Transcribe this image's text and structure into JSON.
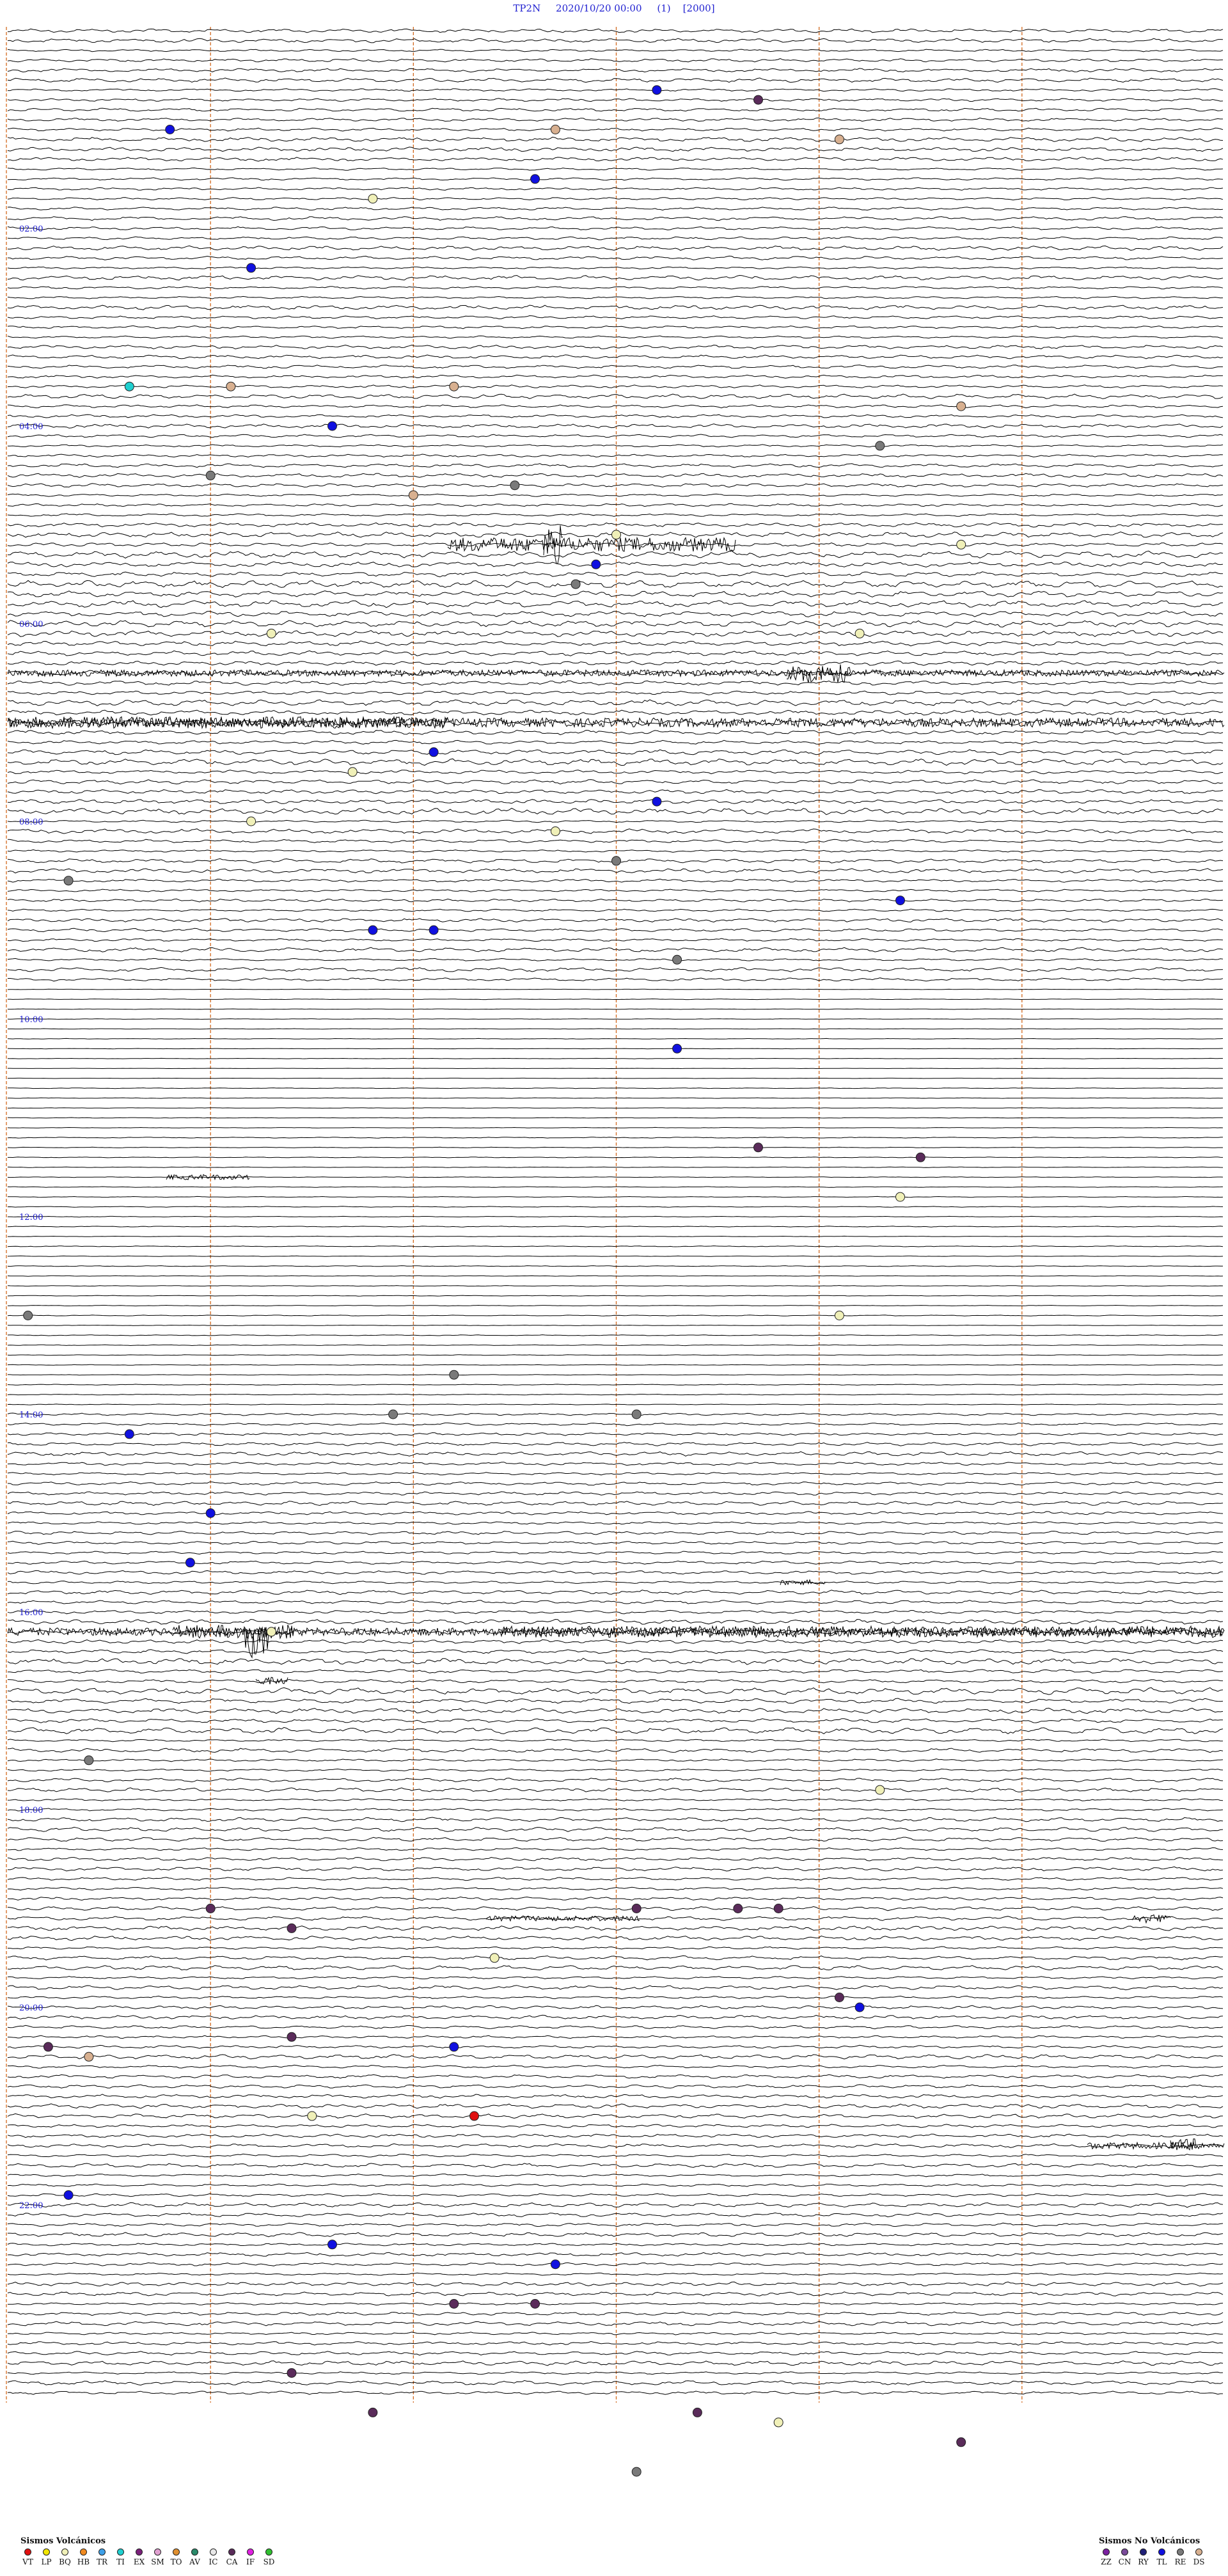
{
  "header": {
    "station": "TP2N",
    "datetime": "2020/10/20 00:00",
    "channel": "(1)",
    "scale": "[2000]"
  },
  "chart_data": {
    "type": "helicorder",
    "title": "TP2N    2020/10/20 00:00    (1)    [2000]",
    "hour_labels": [
      {
        "hour": 2,
        "label": "02:00"
      },
      {
        "hour": 4,
        "label": "04:00"
      },
      {
        "hour": 6,
        "label": "06:00"
      },
      {
        "hour": 8,
        "label": "08:00"
      },
      {
        "hour": 10,
        "label": "10:00"
      },
      {
        "hour": 12,
        "label": "12:00"
      },
      {
        "hour": 14,
        "label": "14:00"
      },
      {
        "hour": 16,
        "label": "16:00"
      },
      {
        "hour": 18,
        "label": "18:00"
      },
      {
        "hour": 20,
        "label": "20:00"
      },
      {
        "hour": 22,
        "label": "22:00"
      }
    ],
    "hours": 24,
    "traces_per_hour": 10,
    "minutes_per_trace": 6,
    "minute_gridlines": [
      1,
      2,
      3,
      4,
      5
    ],
    "trace_colors": {
      "trace": "#000000",
      "grid": "#d2691e",
      "hour_label": "#1f1fd0"
    },
    "events": [
      {
        "time_h": 0.6,
        "minute": 3.2,
        "class": "TL"
      },
      {
        "time_h": 0.7,
        "minute": 3.7,
        "class": "CA"
      },
      {
        "time_h": 1.0,
        "minute": 0.8,
        "class": "TL"
      },
      {
        "time_h": 1.0,
        "minute": 2.7,
        "class": "DS"
      },
      {
        "time_h": 1.1,
        "minute": 4.1,
        "class": "DS"
      },
      {
        "time_h": 1.5,
        "minute": 2.6,
        "class": "TL"
      },
      {
        "time_h": 1.7,
        "minute": 1.8,
        "class": "BQ"
      },
      {
        "time_h": 2.4,
        "minute": 1.2,
        "class": "TL"
      },
      {
        "time_h": 3.6,
        "minute": 0.6,
        "class": "TI"
      },
      {
        "time_h": 3.6,
        "minute": 1.1,
        "class": "DS"
      },
      {
        "time_h": 3.6,
        "minute": 2.2,
        "class": "DS"
      },
      {
        "time_h": 3.8,
        "minute": 4.7,
        "class": "DS"
      },
      {
        "time_h": 4.0,
        "minute": 1.6,
        "class": "TL"
      },
      {
        "time_h": 4.2,
        "minute": 4.3,
        "class": "RE"
      },
      {
        "time_h": 4.5,
        "minute": 1.0,
        "class": "RE"
      },
      {
        "time_h": 4.6,
        "minute": 2.5,
        "class": "RE"
      },
      {
        "time_h": 4.7,
        "minute": 2.0,
        "class": "DS"
      },
      {
        "time_h": 5.1,
        "minute": 3.0,
        "class": "BQ"
      },
      {
        "time_h": 5.2,
        "minute": 4.7,
        "class": "BQ"
      },
      {
        "time_h": 5.4,
        "minute": 2.9,
        "class": "TL"
      },
      {
        "time_h": 5.6,
        "minute": 2.8,
        "class": "RE"
      },
      {
        "time_h": 6.1,
        "minute": 1.3,
        "class": "BQ"
      },
      {
        "time_h": 6.1,
        "minute": 4.2,
        "class": "BQ"
      },
      {
        "time_h": 7.3,
        "minute": 2.1,
        "class": "TL"
      },
      {
        "time_h": 7.5,
        "minute": 1.7,
        "class": "BQ"
      },
      {
        "time_h": 7.8,
        "minute": 3.2,
        "class": "TL"
      },
      {
        "time_h": 8.0,
        "minute": 1.2,
        "class": "BQ"
      },
      {
        "time_h": 8.1,
        "minute": 2.7,
        "class": "BQ"
      },
      {
        "time_h": 8.4,
        "minute": 3.0,
        "class": "RE"
      },
      {
        "time_h": 8.6,
        "minute": 0.3,
        "class": "RE"
      },
      {
        "time_h": 8.8,
        "minute": 4.4,
        "class": "TL"
      },
      {
        "time_h": 9.1,
        "minute": 1.8,
        "class": "TL"
      },
      {
        "time_h": 9.1,
        "minute": 2.1,
        "class": "TL"
      },
      {
        "time_h": 9.4,
        "minute": 3.3,
        "class": "RE"
      },
      {
        "time_h": 10.3,
        "minute": 3.3,
        "class": "TL"
      },
      {
        "time_h": 11.3,
        "minute": 3.7,
        "class": "CA"
      },
      {
        "time_h": 11.4,
        "minute": 4.5,
        "class": "CA"
      },
      {
        "time_h": 11.8,
        "minute": 4.4,
        "class": "BQ"
      },
      {
        "time_h": 13.0,
        "minute": 0.1,
        "class": "RE"
      },
      {
        "time_h": 13.0,
        "minute": 4.1,
        "class": "BQ"
      },
      {
        "time_h": 13.6,
        "minute": 2.2,
        "class": "RE"
      },
      {
        "time_h": 14.0,
        "minute": 1.9,
        "class": "RE"
      },
      {
        "time_h": 14.0,
        "minute": 3.1,
        "class": "RE"
      },
      {
        "time_h": 14.2,
        "minute": 0.6,
        "class": "TL"
      },
      {
        "time_h": 15.0,
        "minute": 1.0,
        "class": "TL"
      },
      {
        "time_h": 15.5,
        "minute": 0.9,
        "class": "TL"
      },
      {
        "time_h": 16.2,
        "minute": 1.3,
        "class": "BQ"
      },
      {
        "time_h": 17.5,
        "minute": 0.4,
        "class": "RE"
      },
      {
        "time_h": 17.8,
        "minute": 4.3,
        "class": "BQ"
      },
      {
        "time_h": 19.0,
        "minute": 1.0,
        "class": "CA"
      },
      {
        "time_h": 19.0,
        "minute": 3.1,
        "class": "CA"
      },
      {
        "time_h": 19.0,
        "minute": 3.6,
        "class": "CA"
      },
      {
        "time_h": 19.0,
        "minute": 3.8,
        "class": "CA"
      },
      {
        "time_h": 19.2,
        "minute": 1.4,
        "class": "CA"
      },
      {
        "time_h": 19.5,
        "minute": 2.4,
        "class": "BQ"
      },
      {
        "time_h": 19.9,
        "minute": 4.1,
        "class": "CA"
      },
      {
        "time_h": 20.0,
        "minute": 4.2,
        "class": "TL"
      },
      {
        "time_h": 20.3,
        "minute": 1.4,
        "class": "CA"
      },
      {
        "time_h": 20.4,
        "minute": 0.2,
        "class": "CA"
      },
      {
        "time_h": 20.4,
        "minute": 2.2,
        "class": "TL"
      },
      {
        "time_h": 20.5,
        "minute": 0.4,
        "class": "DS"
      },
      {
        "time_h": 21.1,
        "minute": 2.3,
        "class": "VT"
      },
      {
        "time_h": 21.1,
        "minute": 1.5,
        "class": "BQ"
      },
      {
        "time_h": 21.9,
        "minute": 0.3,
        "class": "TL"
      },
      {
        "time_h": 22.4,
        "minute": 1.6,
        "class": "TL"
      },
      {
        "time_h": 22.6,
        "minute": 2.7,
        "class": "TL"
      },
      {
        "time_h": 23.0,
        "minute": 2.2,
        "class": "CA"
      },
      {
        "time_h": 23.0,
        "minute": 2.6,
        "class": "CA"
      },
      {
        "time_h": 23.7,
        "minute": 1.4,
        "class": "CA"
      },
      {
        "time_h": 24.1,
        "minute": 1.8,
        "class": "CA"
      },
      {
        "time_h": 24.1,
        "minute": 3.4,
        "class": "CA"
      },
      {
        "time_h": 24.2,
        "minute": 3.8,
        "class": "BQ"
      },
      {
        "time_h": 24.4,
        "minute": 4.7,
        "class": "CA"
      },
      {
        "time_h": 24.7,
        "minute": 3.1,
        "class": "RE"
      }
    ],
    "legend_position": "bottom",
    "grid": true
  },
  "legend": {
    "volcanic": {
      "title": "Sismos Volcánicos",
      "items": [
        {
          "code": "VT",
          "color": "#e01010"
        },
        {
          "code": "LP",
          "color": "#f2e600"
        },
        {
          "code": "BQ",
          "color": "#f0f0b8"
        },
        {
          "code": "HB",
          "color": "#f08a20"
        },
        {
          "code": "TR",
          "color": "#3fa0e8"
        },
        {
          "code": "TI",
          "color": "#20d0d0"
        },
        {
          "code": "EX",
          "color": "#7a1f7a"
        },
        {
          "code": "SM",
          "color": "#e0a0d0"
        },
        {
          "code": "TO",
          "color": "#e09030"
        },
        {
          "code": "AV",
          "color": "#2a8a6a"
        },
        {
          "code": "IC",
          "color": "#e8e8e8"
        },
        {
          "code": "CA",
          "color": "#5a2b5a"
        },
        {
          "code": "IF",
          "color": "#e020e0"
        },
        {
          "code": "SD",
          "color": "#30c030"
        }
      ]
    },
    "non_volcanic": {
      "title": "Sismos No Volcánicos",
      "items": [
        {
          "code": "ZZ",
          "color": "#7a20a0"
        },
        {
          "code": "CN",
          "color": "#7a4a9a"
        },
        {
          "code": "RY",
          "color": "#202078"
        },
        {
          "code": "TL",
          "color": "#1010e0"
        },
        {
          "code": "RE",
          "color": "#7a7a7a"
        },
        {
          "code": "DS",
          "color": "#d8b090"
        }
      ]
    }
  }
}
